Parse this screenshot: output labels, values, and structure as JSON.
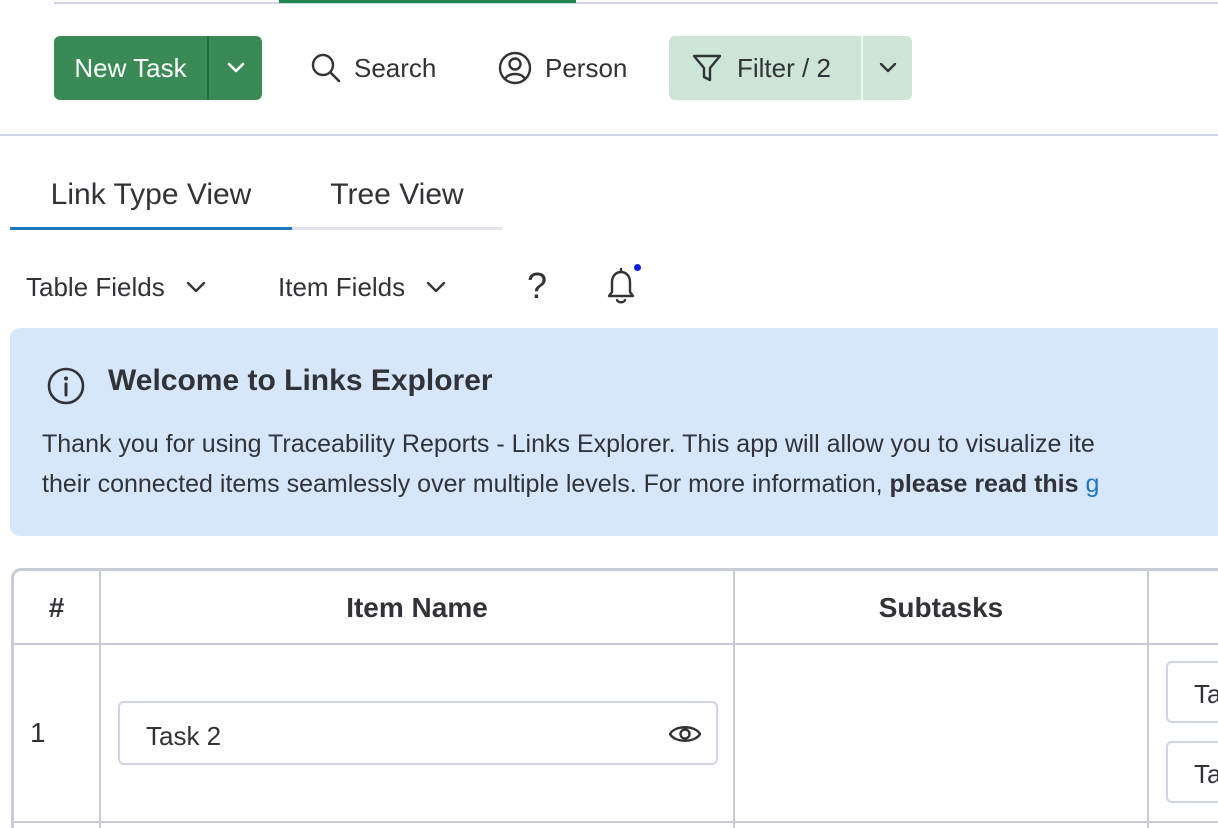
{
  "toolbar": {
    "new_task_label": "New Task",
    "search_label": "Search",
    "person_label": "Person",
    "filter_label": "Filter / 2"
  },
  "tabs": [
    {
      "label": "Link Type View",
      "active": true
    },
    {
      "label": "Tree View",
      "active": false
    }
  ],
  "fields": {
    "table_fields_label": "Table Fields",
    "item_fields_label": "Item Fields",
    "help_label": "?"
  },
  "banner": {
    "title": "Welcome to Links Explorer",
    "line1": "Thank you for using Traceability Reports - Links Explorer. This app will allow you to visualize ite",
    "line2_prefix": "their connected items seamlessly over multiple levels. For more information, ",
    "line2_bold": "please read this",
    "line2_link": "g"
  },
  "table": {
    "headers": [
      "#",
      "Item Name",
      "Subtasks"
    ],
    "rows": [
      {
        "num": "1",
        "item": "Task 2",
        "links": [
          "Ta",
          "Ta"
        ]
      }
    ]
  },
  "colors": {
    "primary_green": "#3a8a55",
    "filter_bg": "#cce5d6",
    "banner_bg": "#d6e7fb",
    "active_tab": "#1f76c2",
    "notification_dot": "#0b1fd8"
  }
}
